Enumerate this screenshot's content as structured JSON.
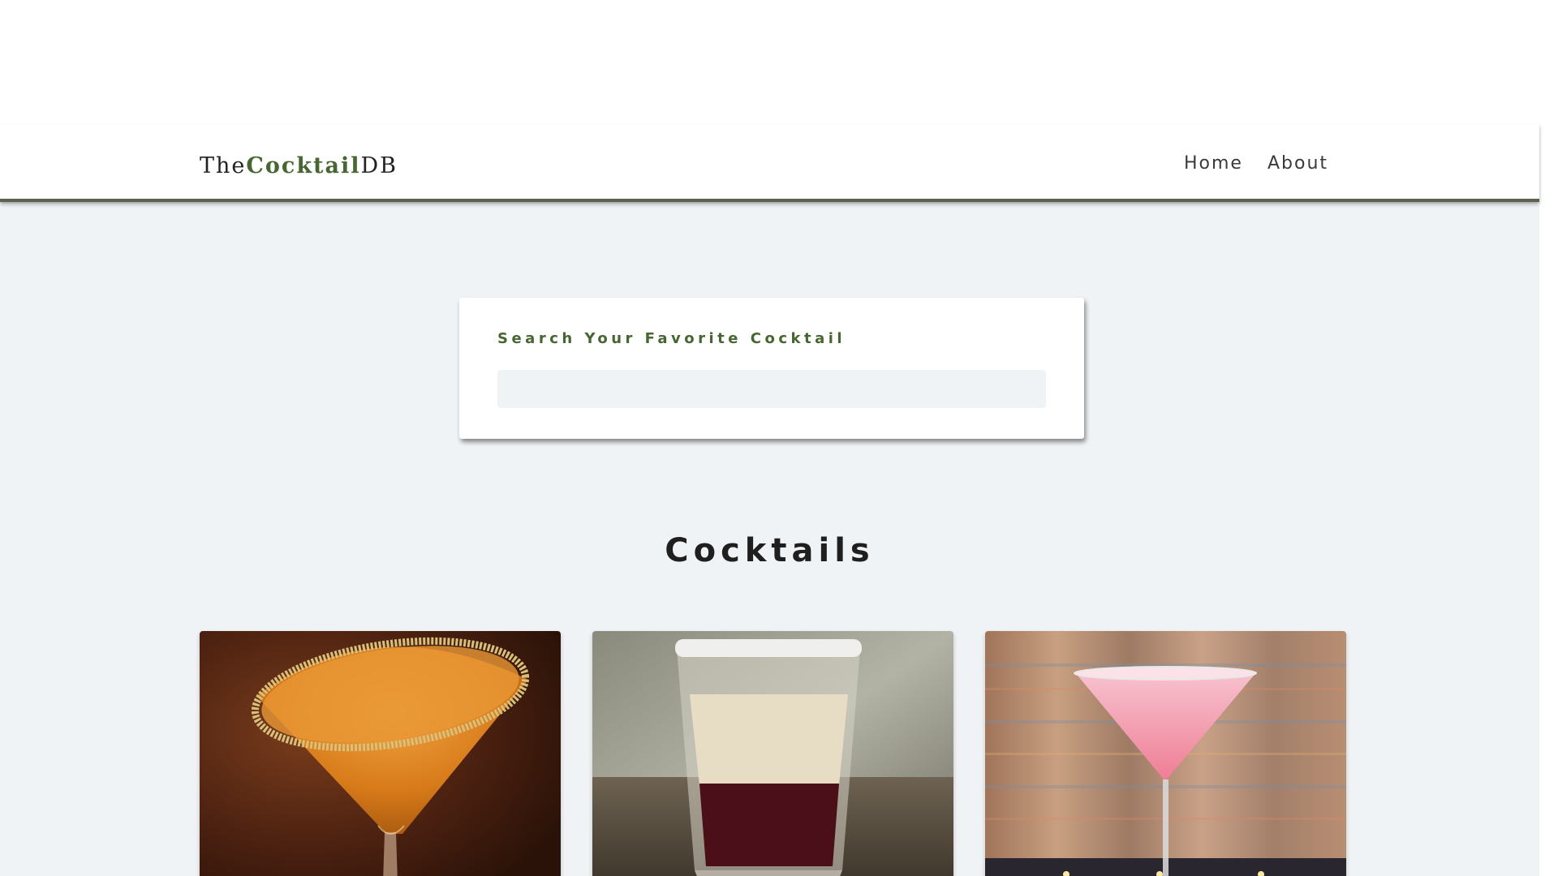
{
  "brand": {
    "prefix": "The",
    "accent": "Cocktail",
    "suffix": "DB",
    "accent_color": "#476631"
  },
  "nav": {
    "links": [
      {
        "label": "Home"
      },
      {
        "label": "About"
      }
    ]
  },
  "search": {
    "label": "Search Your Favorite Cocktail",
    "value": "",
    "placeholder": ""
  },
  "cocktails_section": {
    "title": "Cocktails"
  },
  "cocktail_cards": [
    {
      "image_desc": "orange-martini-sugar-rim-photo"
    },
    {
      "image_desc": "layered-shot-glass-photo"
    },
    {
      "image_desc": "pink-martini-photo"
    }
  ],
  "colors": {
    "page_background": "#f0f3f6",
    "navbar_border": "#5a6350",
    "text_dark": "#222222"
  }
}
